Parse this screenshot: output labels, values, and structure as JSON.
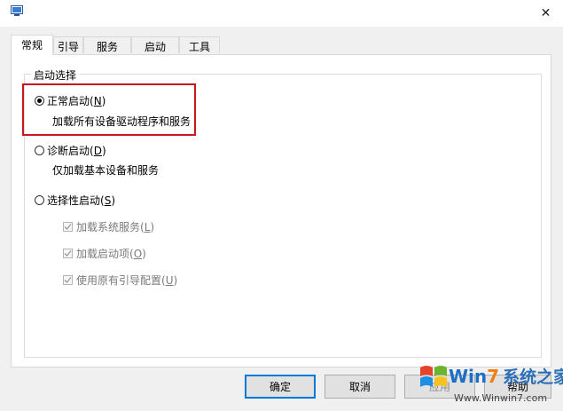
{
  "window": {
    "close_glyph": "✕"
  },
  "tabs": [
    {
      "label": "常规",
      "active": true
    },
    {
      "label": "引导",
      "active": false
    },
    {
      "label": "服务",
      "active": false
    },
    {
      "label": "启动",
      "active": false
    },
    {
      "label": "工具",
      "active": false
    }
  ],
  "startup_selection": {
    "legend": "启动选择",
    "normal": {
      "label_main": "正常启动(",
      "key": "N",
      "label_end": ")",
      "desc": "加载所有设备驱动程序和服务",
      "selected": true
    },
    "diagnostic": {
      "label_main": "诊断启动(",
      "key": "D",
      "label_end": ")",
      "desc": "仅加载基本设备和服务",
      "selected": false
    },
    "selective": {
      "label_main": "选择性启动(",
      "key": "S",
      "label_end": ")",
      "selected": false,
      "options": [
        {
          "label_main": "加载系统服务(",
          "key": "L",
          "label_end": ")",
          "checked": true
        },
        {
          "label_main": "加载启动项(",
          "key": "O",
          "label_end": ")",
          "checked": true
        },
        {
          "label_main": "使用原有引导配置(",
          "key": "U",
          "label_end": ")",
          "checked": true
        }
      ]
    }
  },
  "buttons": {
    "ok": "确定",
    "cancel": "取消",
    "apply": "应用",
    "help": "帮助"
  },
  "watermark": {
    "brand_a": "Win",
    "brand_seven": "7",
    "brand_cn": "系统之家",
    "url": "Www.Winwin7.com"
  },
  "colors": {
    "highlight_border": "#c8161d",
    "default_button_border": "#0078d7"
  }
}
